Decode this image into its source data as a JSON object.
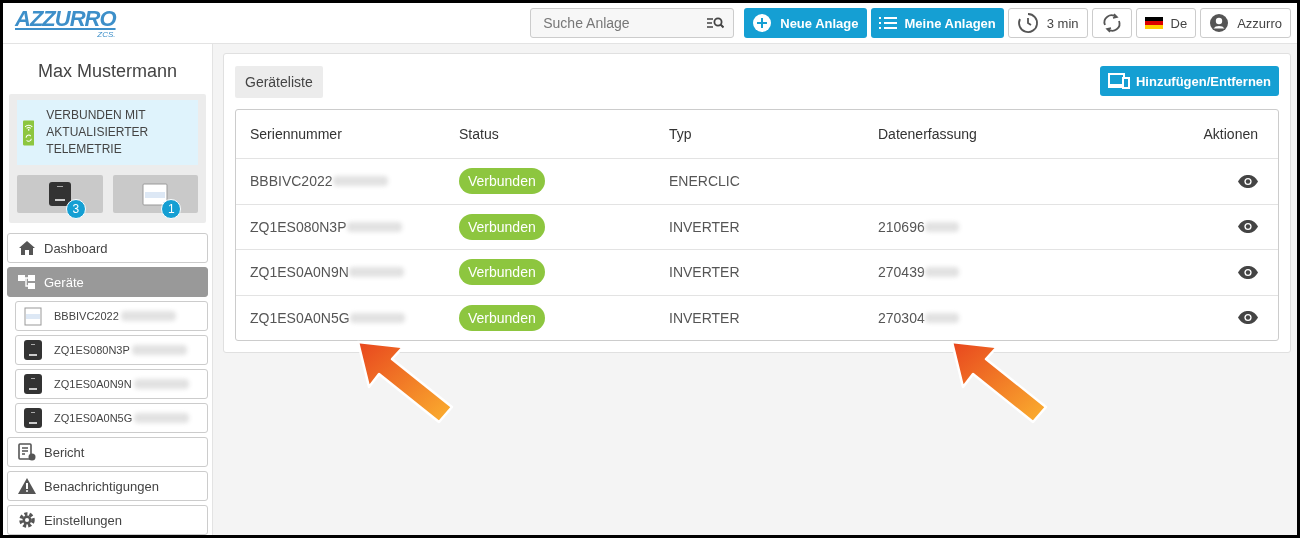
{
  "header": {
    "logo": {
      "main": "AZZURRO",
      "sub": "ZCS."
    },
    "search": {
      "placeholder": "Suche Anlage"
    },
    "buttons": [
      {
        "kind": "new",
        "label": "Neue Anlage"
      },
      {
        "kind": "list",
        "label": "Meine Anlagen"
      },
      {
        "kind": "timer",
        "label": "3 min"
      },
      {
        "kind": "refresh"
      },
      {
        "kind": "language",
        "label": "De"
      },
      {
        "kind": "user",
        "label": "Azzurro"
      }
    ]
  },
  "sidebar": {
    "user_name": "Max Mustermann",
    "status": "VERBUNDEN MIT AKTUALISIERTER TELEMETRIE",
    "device_tiles": [
      {
        "kind": "inverter",
        "count": "3"
      },
      {
        "kind": "meter",
        "count": "1"
      }
    ],
    "items": [
      {
        "kind": "home",
        "label": "Dashboard",
        "selected": false
      },
      {
        "kind": "devices",
        "label": "Geräte",
        "selected": true,
        "children": [
          {
            "kind": "meter",
            "label": "BBBIVC2022",
            "redacted": true
          },
          {
            "kind": "inverter",
            "label": "ZQ1ES080N3P",
            "redacted": true
          },
          {
            "kind": "inverter",
            "label": "ZQ1ES0A0N9N",
            "redacted": true
          },
          {
            "kind": "inverter",
            "label": "ZQ1ES0A0N5G",
            "redacted": true
          }
        ]
      },
      {
        "kind": "report",
        "label": "Bericht",
        "selected": false
      },
      {
        "kind": "alert",
        "label": "Benachrichtigungen",
        "selected": false
      },
      {
        "kind": "settings",
        "label": "Einstellungen",
        "selected": false
      }
    ]
  },
  "main": {
    "tab": "Geräteliste",
    "add_button": "Hinzufügen/Entfernen",
    "table": {
      "columns": [
        "Seriennummer",
        "Status",
        "Typ",
        "Datenerfassung",
        "Aktionen"
      ],
      "rows": [
        {
          "serial": "BBBIVC2022",
          "serial_redacted": true,
          "status": "Verbunden",
          "type": "ENERCLIC"
        },
        {
          "serial": "ZQ1ES080N3P",
          "serial_redacted": true,
          "status": "Verbunden",
          "type": "INVERTER",
          "data_logger": "210696",
          "data_logger_redacted": true
        },
        {
          "serial": "ZQ1ES0A0N9N",
          "serial_redacted": true,
          "status": "Verbunden",
          "type": "INVERTER",
          "data_logger": "270439",
          "data_logger_redacted": true
        },
        {
          "serial": "ZQ1ES0A0N5G",
          "serial_redacted": true,
          "status": "Verbunden",
          "type": "INVERTER",
          "data_logger": "270304",
          "data_logger_redacted": true
        }
      ]
    }
  },
  "annotations": [
    {
      "kind": "arrow"
    },
    {
      "kind": "arrow"
    }
  ]
}
